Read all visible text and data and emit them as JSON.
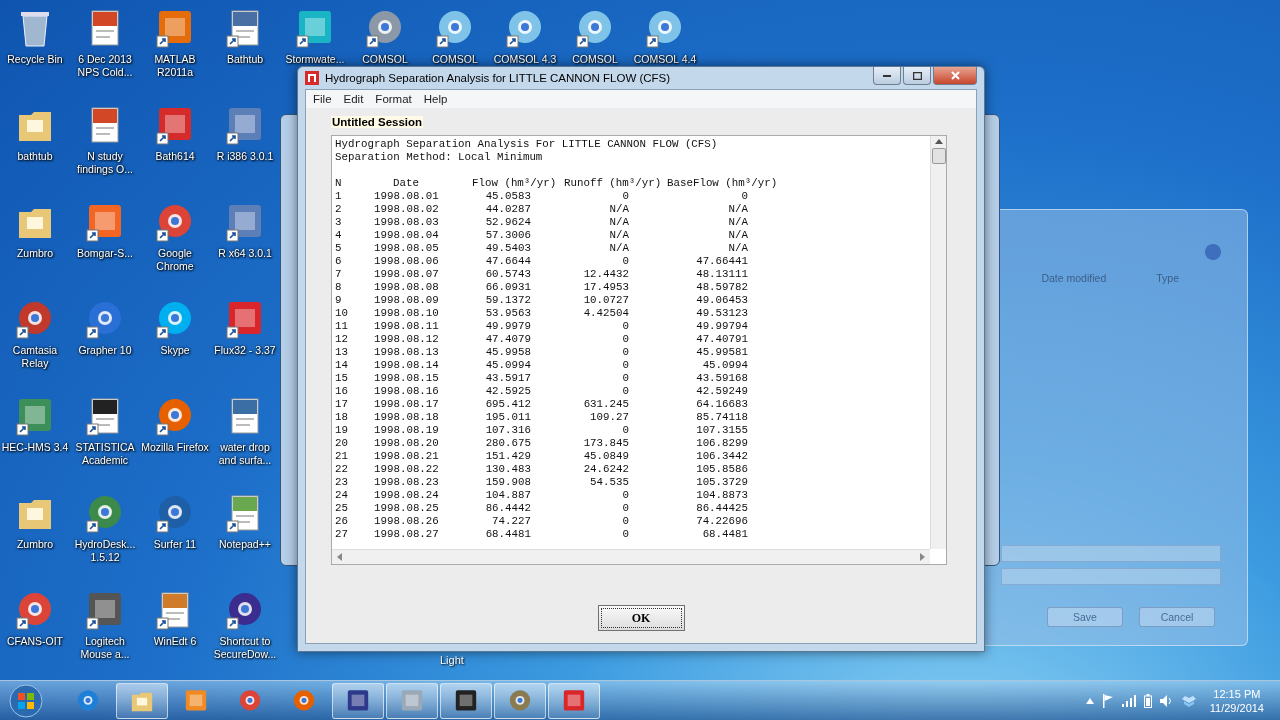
{
  "desktop": {
    "icon_rows": [
      [
        {
          "label": "Recycle Bin",
          "kind": "bin",
          "color": "#9fb7cf",
          "shortcut": false
        },
        {
          "label": "6 Dec 2013 NPS Cold...",
          "kind": "document",
          "color": "#d24726",
          "shortcut": false
        },
        {
          "label": "MATLAB R2011a",
          "kind": "tile",
          "color": "#e46c0a",
          "shortcut": true
        },
        {
          "label": "Bathtub",
          "kind": "document",
          "color": "#4a6fa5",
          "shortcut": true
        },
        {
          "label": "Stormwate...",
          "kind": "tile",
          "color": "#19b5c4",
          "shortcut": true
        },
        {
          "label": "COMSOL",
          "kind": "globe",
          "color": "#8a98a8",
          "shortcut": true
        },
        {
          "label": "COMSOL",
          "kind": "globe",
          "color": "#7fc4e8",
          "shortcut": true
        },
        {
          "label": "COMSOL 4.3",
          "kind": "globe",
          "color": "#7fc4e8",
          "shortcut": true
        },
        {
          "label": "COMSOL",
          "kind": "globe",
          "color": "#7fc4e8",
          "shortcut": true
        },
        {
          "label": "COMSOL 4.4",
          "kind": "globe",
          "color": "#7fc4e8",
          "shortcut": true
        }
      ],
      [
        {
          "label": "bathtub",
          "kind": "folder",
          "color": "#e8c877",
          "shortcut": false
        },
        {
          "label": "N study findings O...",
          "kind": "document",
          "color": "#d24726",
          "shortcut": false
        },
        {
          "label": "Bath614",
          "kind": "tile",
          "color": "#d52b2b",
          "shortcut": true
        },
        {
          "label": "R i386 3.0.1",
          "kind": "tile",
          "color": "#5d7fb8",
          "shortcut": true
        }
      ],
      [
        {
          "label": "Zumbro",
          "kind": "folder",
          "color": "#e8c877",
          "shortcut": false
        },
        {
          "label": "Bomgar-S...",
          "kind": "tile",
          "color": "#f26522",
          "shortcut": true
        },
        {
          "label": "Google Chrome",
          "kind": "globe",
          "color": "#db4437",
          "shortcut": true
        },
        {
          "label": "R x64 3.0.1",
          "kind": "tile",
          "color": "#5d7fb8",
          "shortcut": true
        }
      ],
      [
        {
          "label": "Camtasia Relay",
          "kind": "globe",
          "color": "#c0392b",
          "shortcut": true
        },
        {
          "label": "Grapher 10",
          "kind": "globe",
          "color": "#2a6fd6",
          "shortcut": true
        },
        {
          "label": "Skype",
          "kind": "globe",
          "color": "#00aff0",
          "shortcut": true
        },
        {
          "label": "Flux32 - 3.37",
          "kind": "tile",
          "color": "#d8262b",
          "shortcut": true
        }
      ],
      [
        {
          "label": "HEC-HMS 3.4",
          "kind": "tile",
          "color": "#3d8f5a",
          "shortcut": true
        },
        {
          "label": "STATISTICA Academic",
          "kind": "document",
          "color": "#222222",
          "shortcut": true
        },
        {
          "label": "Mozilla Firefox",
          "kind": "globe",
          "color": "#e66000",
          "shortcut": true
        },
        {
          "label": "water drop and surfa...",
          "kind": "document",
          "color": "#3a6ea5",
          "shortcut": false
        }
      ],
      [
        {
          "label": "Zumbro",
          "kind": "folder",
          "color": "#e8c877",
          "shortcut": false
        },
        {
          "label": "HydroDesk... 1.5.12",
          "kind": "globe",
          "color": "#3b8a4c",
          "shortcut": true
        },
        {
          "label": "Surfer 11",
          "kind": "globe",
          "color": "#1f5fa8",
          "shortcut": true
        },
        {
          "label": "Notepad++",
          "kind": "document",
          "color": "#6aa84f",
          "shortcut": true
        }
      ],
      [
        {
          "label": "CFANS-OIT",
          "kind": "globe",
          "color": "#db4437",
          "shortcut": true
        },
        {
          "label": "Logitech Mouse a...",
          "kind": "tile",
          "color": "#555555",
          "shortcut": true
        },
        {
          "label": "WinEdt 6",
          "kind": "document",
          "color": "#d07b2a",
          "shortcut": true
        },
        {
          "label": "Shortcut to SecureDow...",
          "kind": "globe",
          "color": "#3b2d8f",
          "shortcut": true
        }
      ]
    ],
    "hidden_label": "Light"
  },
  "window": {
    "title": "Hydrograph Separation Analysis for LITTLE CANNON FLOW (CFS)",
    "menu": [
      "File",
      "Edit",
      "Format",
      "Help"
    ],
    "session_tab": "Untitled Session",
    "report": {
      "lines": [
        "Hydrograph Separation Analysis For LITTLE CANNON FLOW (CFS)",
        "Separation Method: Local Minimum"
      ],
      "columns": [
        "N",
        "Date",
        "Flow (hm³/yr)",
        "Runoff (hm³/yr)",
        "BaseFlow (hm³/yr)"
      ],
      "rows": [
        [
          "1",
          "1998.08.01",
          "45.0583",
          "0",
          "0"
        ],
        [
          "2",
          "1998.08.02",
          "44.0287",
          "N/A",
          "N/A"
        ],
        [
          "3",
          "1998.08.03",
          "52.9624",
          "N/A",
          "N/A"
        ],
        [
          "4",
          "1998.08.04",
          "57.3006",
          "N/A",
          "N/A"
        ],
        [
          "5",
          "1998.08.05",
          "49.5403",
          "N/A",
          "N/A"
        ],
        [
          "6",
          "1998.08.06",
          "47.6644",
          "0",
          "47.66441"
        ],
        [
          "7",
          "1998.08.07",
          "60.5743",
          "12.4432",
          "48.13111"
        ],
        [
          "8",
          "1998.08.08",
          "66.0931",
          "17.4953",
          "48.59782"
        ],
        [
          "9",
          "1998.08.09",
          "59.1372",
          "10.0727",
          "49.06453"
        ],
        [
          "10",
          "1998.08.10",
          "53.9563",
          "4.42504",
          "49.53123"
        ],
        [
          "11",
          "1998.08.11",
          "49.9979",
          "0",
          "49.99794"
        ],
        [
          "12",
          "1998.08.12",
          "47.4079",
          "0",
          "47.40791"
        ],
        [
          "13",
          "1998.08.13",
          "45.9958",
          "0",
          "45.99581"
        ],
        [
          "14",
          "1998.08.14",
          "45.0994",
          "0",
          "45.0994"
        ],
        [
          "15",
          "1998.08.15",
          "43.5917",
          "0",
          "43.59168"
        ],
        [
          "16",
          "1998.08.16",
          "42.5925",
          "0",
          "42.59249"
        ],
        [
          "17",
          "1998.08.17",
          "695.412",
          "631.245",
          "64.16683"
        ],
        [
          "18",
          "1998.08.18",
          "195.011",
          "109.27",
          "85.74118"
        ],
        [
          "19",
          "1998.08.19",
          "107.316",
          "0",
          "107.3155"
        ],
        [
          "20",
          "1998.08.20",
          "280.675",
          "173.845",
          "106.8299"
        ],
        [
          "21",
          "1998.08.21",
          "151.429",
          "45.0849",
          "106.3442"
        ],
        [
          "22",
          "1998.08.22",
          "130.483",
          "24.6242",
          "105.8586"
        ],
        [
          "23",
          "1998.08.23",
          "159.908",
          "54.535",
          "105.3729"
        ],
        [
          "24",
          "1998.08.24",
          "104.887",
          "0",
          "104.8873"
        ],
        [
          "25",
          "1998.08.25",
          "86.4442",
          "0",
          "86.44425"
        ],
        [
          "26",
          "1998.08.26",
          "74.227",
          "0",
          "74.22696"
        ],
        [
          "27",
          "1998.08.27",
          "68.4481",
          "0",
          "68.4481"
        ]
      ]
    },
    "ok_button": "OK"
  },
  "save_dialog": {
    "columns": [
      "Date modified",
      "Type"
    ],
    "buttons": [
      "Save",
      "Cancel"
    ]
  },
  "taskbar": {
    "apps": [
      {
        "kind": "globe",
        "color": "#1e7fd6",
        "open": false
      },
      {
        "kind": "folder",
        "color": "#e8c877",
        "open": true
      },
      {
        "kind": "tile",
        "color": "#f08a24",
        "open": false
      },
      {
        "kind": "globe",
        "color": "#db4437",
        "open": false
      },
      {
        "kind": "globe",
        "color": "#e66000",
        "open": false
      },
      {
        "kind": "tile",
        "color": "#2d3a8c",
        "open": true
      },
      {
        "kind": "tile",
        "color": "#9aa9b8",
        "open": true
      },
      {
        "kind": "tile",
        "color": "#222222",
        "open": true
      },
      {
        "kind": "globe",
        "color": "#8a7a50",
        "open": true
      },
      {
        "kind": "tile",
        "color": "#d8262b",
        "open": true
      }
    ],
    "clock": {
      "time": "12:15 PM",
      "date": "11/29/2014"
    }
  }
}
